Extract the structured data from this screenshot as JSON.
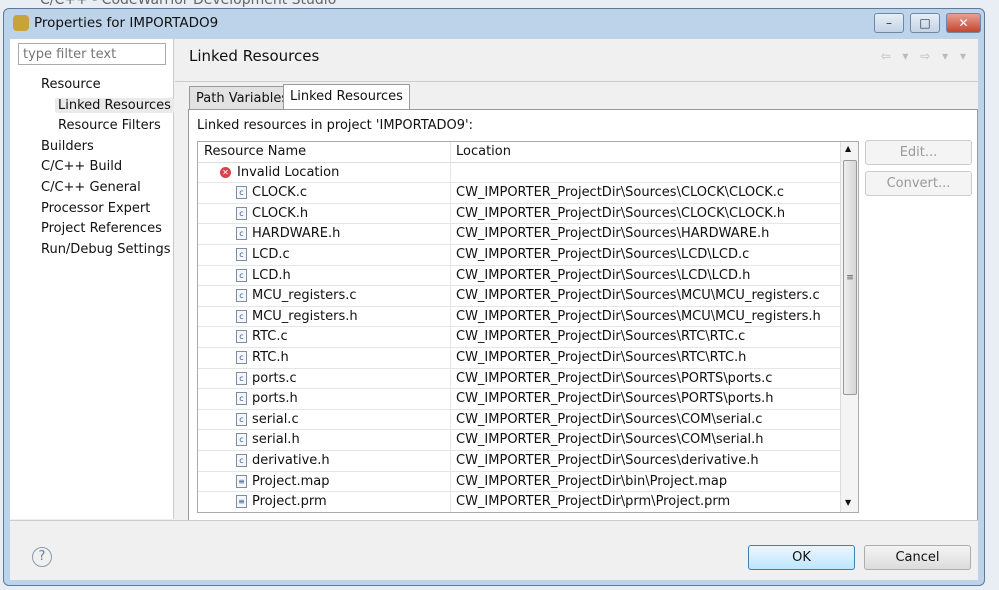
{
  "background_title": "C/C++ - CodeWarrior Development Studio",
  "window": {
    "title": "Properties for IMPORTADO9",
    "controls": {
      "minimize": "–",
      "maximize": "□",
      "close": "✕"
    }
  },
  "filter": {
    "placeholder": "type filter text",
    "value": ""
  },
  "tree": [
    {
      "label": "Resource",
      "level": 0
    },
    {
      "label": "Linked Resources",
      "level": 1,
      "selected": true
    },
    {
      "label": "Resource Filters",
      "level": 1
    },
    {
      "label": "Builders",
      "level": 0
    },
    {
      "label": "C/C++ Build",
      "level": 0
    },
    {
      "label": "C/C++ General",
      "level": 0
    },
    {
      "label": "Processor Expert",
      "level": 0
    },
    {
      "label": "Project References",
      "level": 0
    },
    {
      "label": "Run/Debug Settings",
      "level": 0
    }
  ],
  "page": {
    "title": "Linked Resources",
    "nav_icons": "⇦ ▾ ⇨ ▾ ▾"
  },
  "tabs": [
    {
      "label": "Path Variables",
      "active": false
    },
    {
      "label": "Linked Resources",
      "active": true
    }
  ],
  "caption": "Linked resources in project 'IMPORTADO9':",
  "table": {
    "columns": [
      "Resource Name",
      "Location"
    ],
    "group": {
      "label": "Invalid Location",
      "icon": "error-icon"
    },
    "rows": [
      {
        "name": "CLOCK.c",
        "location": "CW_IMPORTER_ProjectDir\\Sources\\CLOCK\\CLOCK.c",
        "icon": "c-file"
      },
      {
        "name": "CLOCK.h",
        "location": "CW_IMPORTER_ProjectDir\\Sources\\CLOCK\\CLOCK.h",
        "icon": "c-file"
      },
      {
        "name": "HARDWARE.h",
        "location": "CW_IMPORTER_ProjectDir\\Sources\\HARDWARE.h",
        "icon": "c-file"
      },
      {
        "name": "LCD.c",
        "location": "CW_IMPORTER_ProjectDir\\Sources\\LCD\\LCD.c",
        "icon": "c-file"
      },
      {
        "name": "LCD.h",
        "location": "CW_IMPORTER_ProjectDir\\Sources\\LCD\\LCD.h",
        "icon": "c-file"
      },
      {
        "name": "MCU_registers.c",
        "location": "CW_IMPORTER_ProjectDir\\Sources\\MCU\\MCU_registers.c",
        "icon": "c-file"
      },
      {
        "name": "MCU_registers.h",
        "location": "CW_IMPORTER_ProjectDir\\Sources\\MCU\\MCU_registers.h",
        "icon": "c-file"
      },
      {
        "name": "RTC.c",
        "location": "CW_IMPORTER_ProjectDir\\Sources\\RTC\\RTC.c",
        "icon": "c-file"
      },
      {
        "name": "RTC.h",
        "location": "CW_IMPORTER_ProjectDir\\Sources\\RTC\\RTC.h",
        "icon": "c-file"
      },
      {
        "name": "ports.c",
        "location": "CW_IMPORTER_ProjectDir\\Sources\\PORTS\\ports.c",
        "icon": "c-file"
      },
      {
        "name": "ports.h",
        "location": "CW_IMPORTER_ProjectDir\\Sources\\PORTS\\ports.h",
        "icon": "c-file"
      },
      {
        "name": "serial.c",
        "location": "CW_IMPORTER_ProjectDir\\Sources\\COM\\serial.c",
        "icon": "c-file"
      },
      {
        "name": "serial.h",
        "location": "CW_IMPORTER_ProjectDir\\Sources\\COM\\serial.h",
        "icon": "c-file"
      },
      {
        "name": "derivative.h",
        "location": "CW_IMPORTER_ProjectDir\\Sources\\derivative.h",
        "icon": "c-file"
      },
      {
        "name": "Project.map",
        "location": "CW_IMPORTER_ProjectDir\\bin\\Project.map",
        "icon": "text-file"
      },
      {
        "name": "Project.prm",
        "location": "CW_IMPORTER_ProjectDir\\prm\\Project.prm",
        "icon": "text-file"
      }
    ]
  },
  "buttons": {
    "edit": "Edit...",
    "convert": "Convert...",
    "ok": "OK",
    "cancel": "Cancel",
    "help": "?"
  }
}
